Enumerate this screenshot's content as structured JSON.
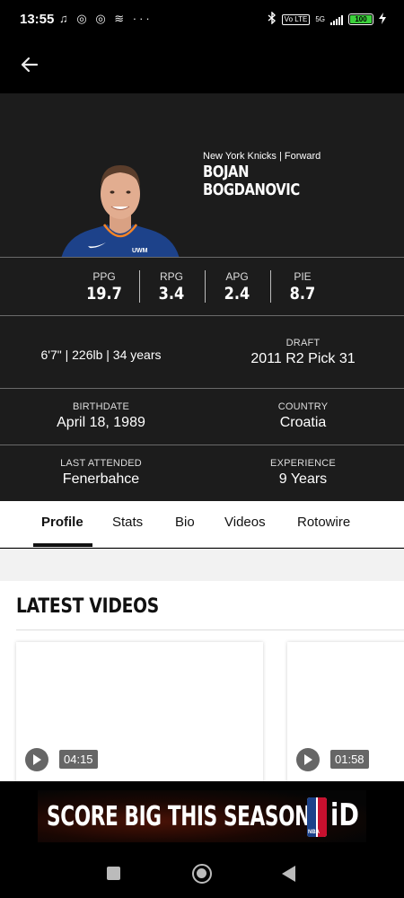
{
  "status_bar": {
    "time": "13:55",
    "notification_icons": "♫ ◎ ◎ ≋ ···",
    "volte": "Vo LTE",
    "network": "5G",
    "battery": "100"
  },
  "header": {
    "back_icon": "arrow-left-icon"
  },
  "player": {
    "team_position": "New York Knicks | Forward",
    "first_name": "BOJAN",
    "last_name": "BOGDANOVIC",
    "jersey_sponsor": "UWM"
  },
  "stats": [
    {
      "label": "PPG",
      "value": "19.7"
    },
    {
      "label": "RPG",
      "value": "3.4"
    },
    {
      "label": "APG",
      "value": "2.4"
    },
    {
      "label": "PIE",
      "value": "8.7"
    }
  ],
  "info": {
    "physical": "6'7\" | 226lb | 34 years",
    "draft_label": "DRAFT",
    "draft_value": "2011 R2 Pick 31",
    "birthdate_label": "BIRTHDATE",
    "birthdate_value": "April 18, 1989",
    "country_label": "COUNTRY",
    "country_value": "Croatia",
    "last_attended_label": "LAST ATTENDED",
    "last_attended_value": "Fenerbahce",
    "experience_label": "EXPERIENCE",
    "experience_value": "9 Years"
  },
  "tabs": [
    {
      "label": "Profile",
      "active": true
    },
    {
      "label": "Stats"
    },
    {
      "label": "Bio"
    },
    {
      "label": "Videos"
    },
    {
      "label": "Rotowire"
    }
  ],
  "latest_videos": {
    "title": "LATEST VIDEOS",
    "items": [
      {
        "duration": "04:15"
      },
      {
        "duration": "01:58"
      }
    ]
  },
  "ad": {
    "text": "SCORE BIG THIS SEASON",
    "logo_small": "NBA",
    "logo_text": "iD"
  },
  "colors": {
    "hero_bg": "#1c1c1c",
    "jersey": "#1d428a",
    "accent_orange": "#f58426"
  }
}
